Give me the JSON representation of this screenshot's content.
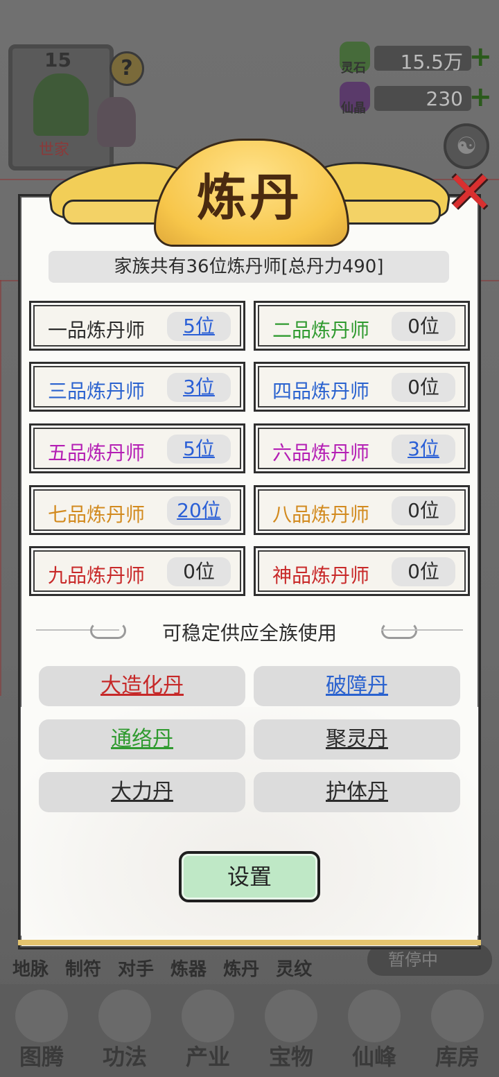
{
  "background": {
    "level": "15",
    "family_tag": "世家",
    "resources": [
      {
        "label": "灵石",
        "value": "15.5万",
        "icon": "spirit-stone-icon"
      },
      {
        "label": "仙晶",
        "value": "230",
        "icon": "immortal-crystal-icon"
      }
    ],
    "sub_tabs": [
      "地脉",
      "制符",
      "对手",
      "炼器",
      "炼丹",
      "灵纹"
    ],
    "pause_label": "暂停中",
    "nav": [
      "图腾",
      "功法",
      "产业",
      "宝物",
      "仙峰",
      "库房"
    ]
  },
  "dialog": {
    "title": "炼丹",
    "summary": "家族共有36位炼丹师[总丹力490]",
    "grades": [
      {
        "label": "一品炼丹师",
        "count": "5位",
        "color": "#2b2b2b",
        "link": true
      },
      {
        "label": "二品炼丹师",
        "count": "0位",
        "color": "#2f9a2f",
        "link": false
      },
      {
        "label": "三品炼丹师",
        "count": "3位",
        "color": "#2a62cf",
        "link": true
      },
      {
        "label": "四品炼丹师",
        "count": "0位",
        "color": "#2a62cf",
        "link": false
      },
      {
        "label": "五品炼丹师",
        "count": "5位",
        "color": "#b41eb4",
        "link": true
      },
      {
        "label": "六品炼丹师",
        "count": "3位",
        "color": "#b41eb4",
        "link": true
      },
      {
        "label": "七品炼丹师",
        "count": "20位",
        "color": "#d28a1e",
        "link": true
      },
      {
        "label": "八品炼丹师",
        "count": "0位",
        "color": "#d28a1e",
        "link": false
      },
      {
        "label": "九品炼丹师",
        "count": "0位",
        "color": "#c82828",
        "link": false
      },
      {
        "label": "神品炼丹师",
        "count": "0位",
        "color": "#c82828",
        "link": false
      }
    ],
    "section_title": "可稳定供应全族使用",
    "pills": [
      {
        "label": "大造化丹",
        "color": "#c62828"
      },
      {
        "label": "破障丹",
        "color": "#2a62cf"
      },
      {
        "label": "通络丹",
        "color": "#2f9a2f"
      },
      {
        "label": "聚灵丹",
        "color": "#2b2b2b"
      },
      {
        "label": "大力丹",
        "color": "#2b2b2b"
      },
      {
        "label": "护体丹",
        "color": "#2b2b2b"
      }
    ],
    "settings_label": "设置"
  }
}
